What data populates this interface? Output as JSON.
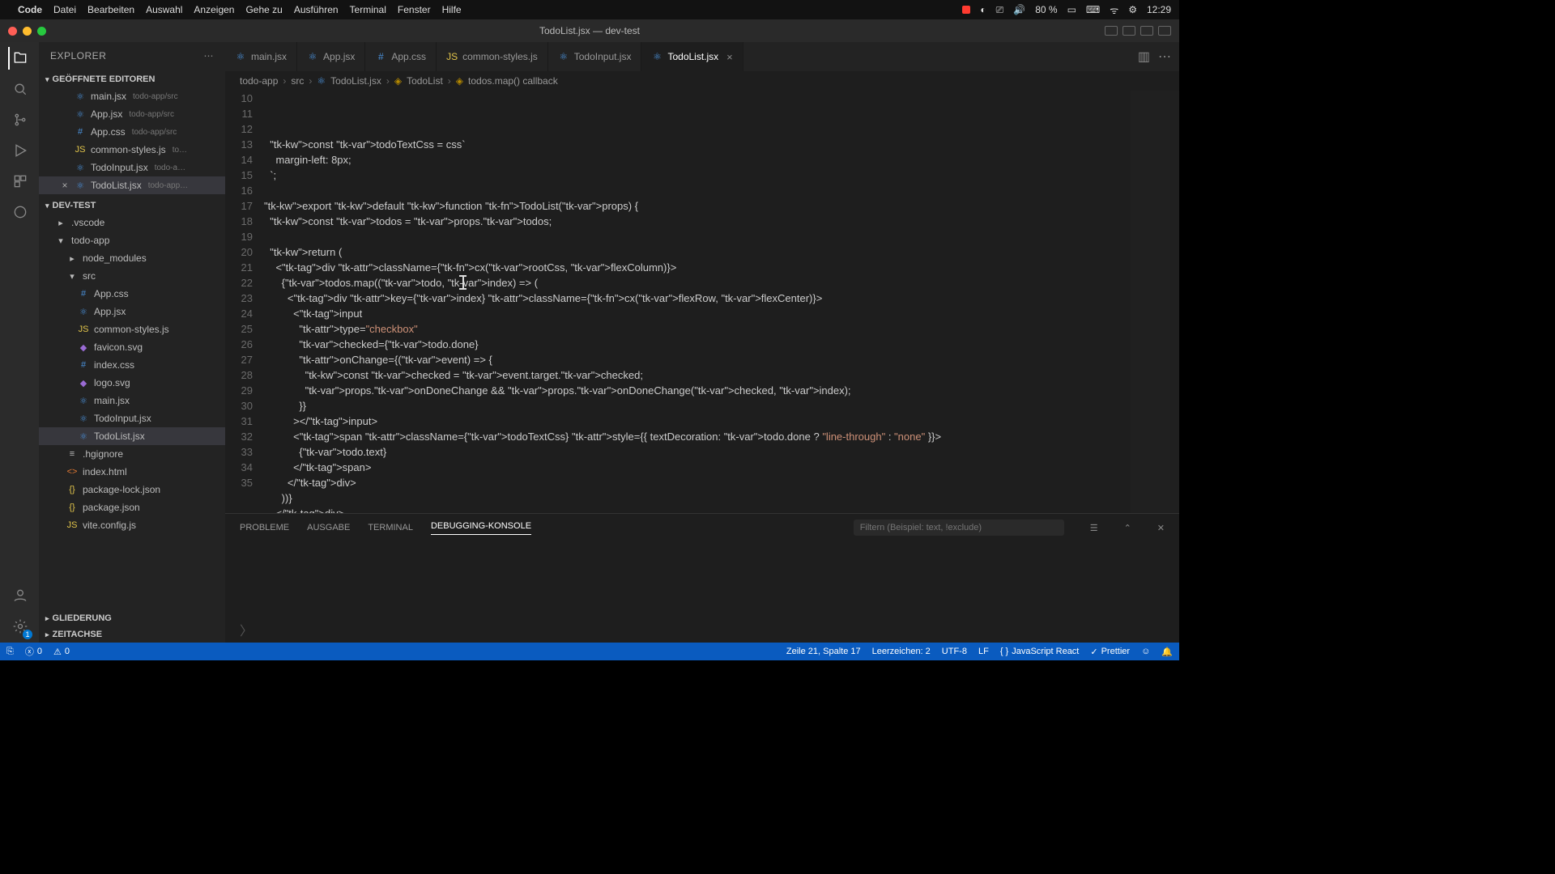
{
  "mac_menu": {
    "app": "Code",
    "items": [
      "Datei",
      "Bearbeiten",
      "Auswahl",
      "Anzeigen",
      "Gehe zu",
      "Ausführen",
      "Terminal",
      "Fenster",
      "Hilfe"
    ],
    "right": {
      "battery": "80 %",
      "wifi": "",
      "clock": "12:29"
    }
  },
  "window": {
    "title": "TodoList.jsx — dev-test"
  },
  "sidebar": {
    "title": "EXPLORER",
    "open_editors_label": "GEÖFFNETE EDITOREN",
    "open_editors": [
      {
        "name": "main.jsx",
        "path": "todo-app/src",
        "icon": "react"
      },
      {
        "name": "App.jsx",
        "path": "todo-app/src",
        "icon": "react"
      },
      {
        "name": "App.css",
        "path": "todo-app/src",
        "icon": "css"
      },
      {
        "name": "common-styles.js",
        "path": "to…",
        "icon": "js"
      },
      {
        "name": "TodoInput.jsx",
        "path": "todo-a…",
        "icon": "react"
      },
      {
        "name": "TodoList.jsx",
        "path": "todo-app…",
        "icon": "react",
        "active": true
      }
    ],
    "project_label": "DEV-TEST",
    "tree": [
      {
        "name": ".vscode",
        "kind": "folder",
        "depth": 1
      },
      {
        "name": "todo-app",
        "kind": "folder",
        "depth": 1,
        "open": true
      },
      {
        "name": "node_modules",
        "kind": "folder",
        "depth": 2
      },
      {
        "name": "src",
        "kind": "folder",
        "depth": 2,
        "open": true
      },
      {
        "name": "App.css",
        "kind": "css",
        "depth": 3
      },
      {
        "name": "App.jsx",
        "kind": "react",
        "depth": 3
      },
      {
        "name": "common-styles.js",
        "kind": "js",
        "depth": 3
      },
      {
        "name": "favicon.svg",
        "kind": "svg",
        "depth": 3
      },
      {
        "name": "index.css",
        "kind": "css",
        "depth": 3
      },
      {
        "name": "logo.svg",
        "kind": "svg",
        "depth": 3
      },
      {
        "name": "main.jsx",
        "kind": "react",
        "depth": 3
      },
      {
        "name": "TodoInput.jsx",
        "kind": "react",
        "depth": 3
      },
      {
        "name": "TodoList.jsx",
        "kind": "react",
        "depth": 3,
        "active": true
      },
      {
        "name": ".hgignore",
        "kind": "file",
        "depth": 2
      },
      {
        "name": "index.html",
        "kind": "html",
        "depth": 2
      },
      {
        "name": "package-lock.json",
        "kind": "json",
        "depth": 2
      },
      {
        "name": "package.json",
        "kind": "json",
        "depth": 2
      },
      {
        "name": "vite.config.js",
        "kind": "js",
        "depth": 2
      }
    ],
    "outline_label": "GLIEDERUNG",
    "timeline_label": "ZEITACHSE"
  },
  "tabs": [
    {
      "label": "main.jsx",
      "icon": "react"
    },
    {
      "label": "App.jsx",
      "icon": "react"
    },
    {
      "label": "App.css",
      "icon": "css"
    },
    {
      "label": "common-styles.js",
      "icon": "js"
    },
    {
      "label": "TodoInput.jsx",
      "icon": "react"
    },
    {
      "label": "TodoList.jsx",
      "icon": "react",
      "active": true
    }
  ],
  "breadcrumb": [
    "todo-app",
    "src",
    "TodoList.jsx",
    "TodoList",
    "todos.map() callback"
  ],
  "code": {
    "first_line": 10,
    "lines": [
      "  const todoTextCss = css`",
      "    margin-left: 8px;",
      "  `;",
      "",
      "export default function TodoList(props) {",
      "  const todos = props.todos;",
      "",
      "  return (",
      "    <div className={cx(rootCss, flexColumn)}>",
      "      {todos.map((todo, index) => (",
      "        <div key={index} className={cx(flexRow, flexCenter)}>",
      "          <input",
      "            type=\"checkbox\"",
      "            checked={todo.done}",
      "            onChange={(event) => {",
      "              const checked = event.target.checked;",
      "              props.onDoneChange && props.onDoneChange(checked, index);",
      "            }}",
      "          ></input>",
      "          <span className={todoTextCss} style={{ textDecoration: todo.done ? \"line-through\" : \"none\" }}>",
      "            {todo.text}",
      "          </span>",
      "        </div>",
      "      ))}",
      "    </div>",
      "  );"
    ]
  },
  "panel": {
    "tabs": [
      "PROBLEME",
      "AUSGABE",
      "TERMINAL",
      "DEBUGGING-KONSOLE"
    ],
    "active": "DEBUGGING-KONSOLE",
    "filter_placeholder": "Filtern (Beispiel: text, !exclude)"
  },
  "status": {
    "errors": "0",
    "warnings": "0",
    "position": "Zeile 21, Spalte 17",
    "spaces": "Leerzeichen: 2",
    "encoding": "UTF-8",
    "eol": "LF",
    "lang": "JavaScript React",
    "prettier": "Prettier"
  }
}
